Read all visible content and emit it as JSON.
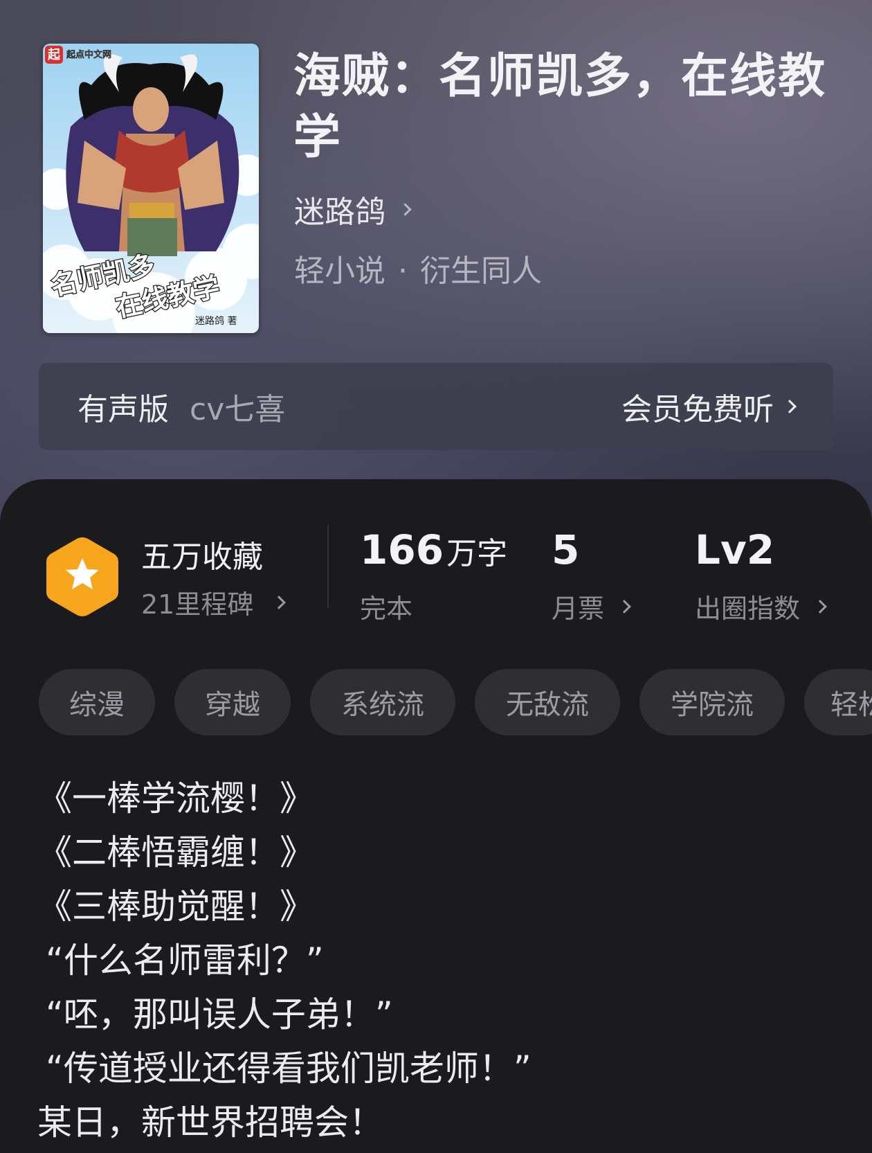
{
  "book": {
    "title": "海贼：名师凯多，在线教学",
    "author": "迷路鸽",
    "category": "轻小说",
    "subcategory": "衍生同人",
    "cover": {
      "publisher": "起点中文网",
      "publisher_logo_char": "起",
      "title_line1": "名师凯多",
      "title_line2": "在线教学",
      "author_sign": "迷路鸽 著"
    }
  },
  "audio": {
    "label": "有声版",
    "narrator": "cv七喜",
    "action": "会员免费听"
  },
  "stats": {
    "favorites": "五万收藏",
    "milestones": "21里程碑",
    "word_count_number": "166",
    "word_count_unit": "万字",
    "status": "完本",
    "monthly_votes": "5",
    "monthly_votes_label": "月票",
    "level": "Lv2",
    "level_label": "出圈指数"
  },
  "tags": [
    "综漫",
    "穿越",
    "系统流",
    "无敌流",
    "学院流",
    "轻松"
  ],
  "synopsis": [
    "《一棒学流樱！》",
    "《二棒悟霸缠！》",
    "《三棒助觉醒！》",
    "“什么名师雷利？”",
    "“呸，那叫误人子弟！”",
    "“传道授业还得看我们凯老师！”",
    "某日，新世界招聘会！"
  ],
  "colors": {
    "badge": "#f7a51c",
    "panel": "#1b1b1d",
    "tag_bg": "#2f2f33"
  },
  "icons": {
    "badge": "star-hexagon-icon",
    "chevron": "chevron-right-icon"
  }
}
